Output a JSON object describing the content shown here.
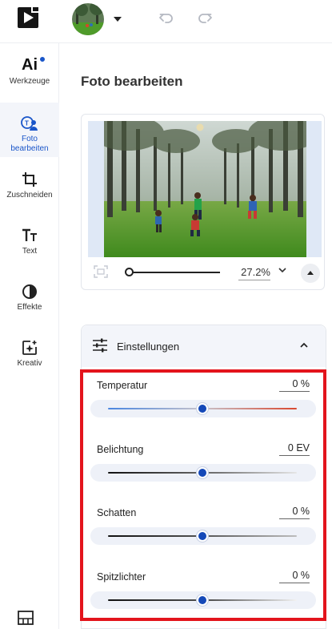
{
  "header": {
    "icons": [
      "app-logo-icon",
      "chevron-down-icon",
      "undo-icon",
      "redo-icon"
    ]
  },
  "sidebar": {
    "items": [
      {
        "id": "ai",
        "icon_text": "Ai",
        "label": "Werkzeuge",
        "badge": true
      },
      {
        "id": "photo",
        "icon": "photo-edit-icon",
        "label_line1": "Foto",
        "label_line2": "bearbeiten",
        "active": true
      },
      {
        "id": "crop",
        "icon": "crop-icon",
        "label": "Zuschneiden"
      },
      {
        "id": "text",
        "icon": "text-icon",
        "label": "Text"
      },
      {
        "id": "effects",
        "icon": "effects-icon",
        "label": "Effekte"
      },
      {
        "id": "creative",
        "icon": "creative-icon",
        "label": "Kreativ"
      }
    ]
  },
  "panel": {
    "title": "Foto bearbeiten",
    "preview": {
      "zoom": "27.2%",
      "zoom_slider_fraction": 0.0
    },
    "settings": {
      "label": "Einstellungen",
      "sliders": [
        {
          "label": "Temperatur",
          "value": "0 %",
          "position": 0.5,
          "style": "temperature"
        },
        {
          "label": "Belichtung",
          "value": "0 EV",
          "position": 0.5,
          "style": "exposure"
        },
        {
          "label": "Schatten",
          "value": "0 %",
          "position": 0.5,
          "style": "shadows"
        },
        {
          "label": "Spitzlichter",
          "value": "0 %",
          "position": 0.5,
          "style": "highlights"
        }
      ]
    }
  },
  "colors": {
    "accent": "#1a56c9",
    "knob": "#1549b8",
    "highlight_box": "#e3141c"
  }
}
